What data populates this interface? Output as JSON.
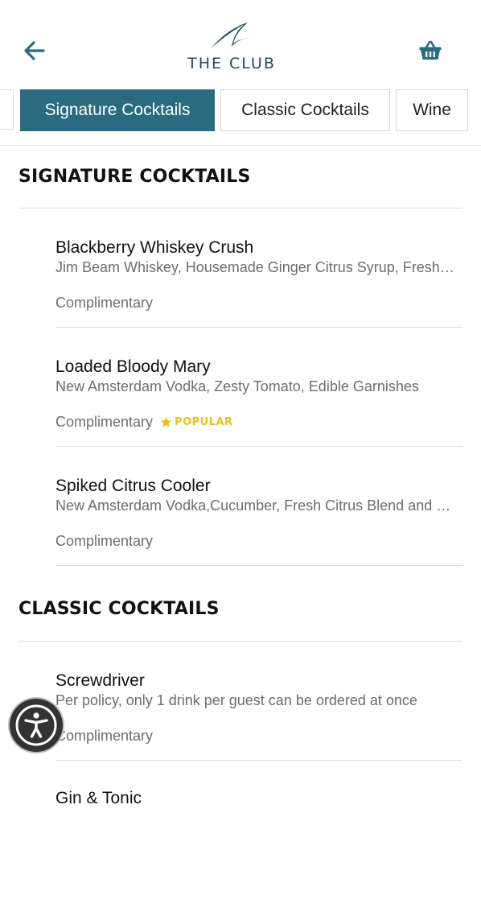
{
  "header": {
    "logo_text": "THE CLUB",
    "back_icon": "arrow-left-icon",
    "cart_icon": "basket-icon",
    "accent_color": "#2a6b80"
  },
  "tabs": [
    {
      "label": "Signature Cocktails",
      "active": true
    },
    {
      "label": "Classic Cocktails",
      "active": false
    },
    {
      "label": "Wine",
      "active": false
    }
  ],
  "sections": [
    {
      "title": "SIGNATURE COCKTAILS",
      "items": [
        {
          "name": "Blackberry Whiskey Crush",
          "description": "Jim Beam Whiskey, Housemade Ginger Citrus Syrup, Fresh Blackberries",
          "price": "Complimentary",
          "badge": ""
        },
        {
          "name": "Loaded Bloody Mary",
          "description": "New Amsterdam Vodka, Zesty Tomato, Edible Garnishes",
          "price": "Complimentary",
          "badge": "POPULAR"
        },
        {
          "name": "Spiked Citrus Cooler",
          "description": "New Amsterdam Vodka,Cucumber, Fresh Citrus Blend and Soda",
          "price": "Complimentary",
          "badge": ""
        }
      ]
    },
    {
      "title": "CLASSIC COCKTAILS",
      "items": [
        {
          "name": "Screwdriver",
          "description": "Per policy, only 1 drink per guest can be ordered at once",
          "price": "Complimentary",
          "badge": ""
        },
        {
          "name": "Gin & Tonic",
          "description": "",
          "price": "",
          "badge": ""
        }
      ]
    }
  ],
  "accessibility": {
    "icon": "accessibility-icon"
  },
  "colors": {
    "badge": "#e8c020",
    "muted_text": "#6d6d6d"
  }
}
